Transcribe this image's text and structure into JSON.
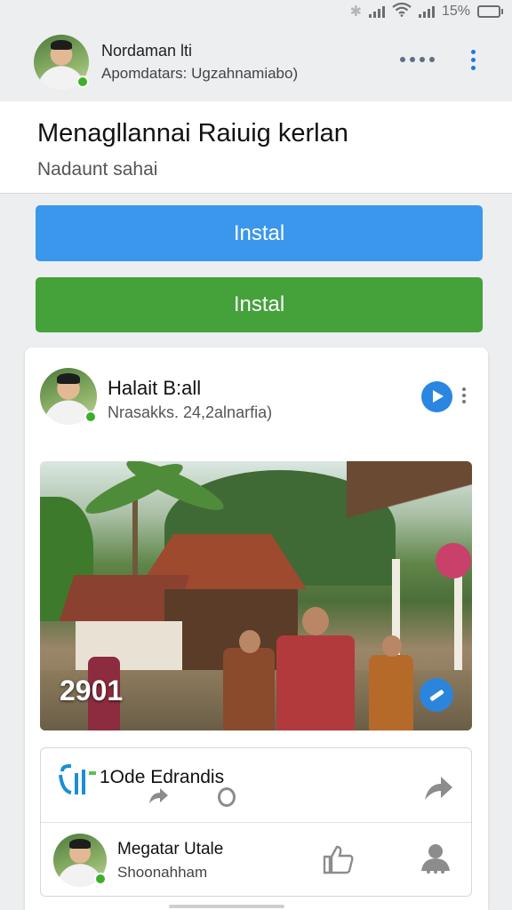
{
  "status": {
    "battery": "15%"
  },
  "header": {
    "user_name": "Nordaman lti",
    "user_sub": "Apomdatars: Ugzahnamiabo)"
  },
  "title_card": {
    "title": "Menagllannai Raiuig kerlan",
    "subtitle": "Nadaunt sahai"
  },
  "buttons": {
    "primary_label": "Instal",
    "secondary_label": "Instal",
    "primary_color": "#3b97ec",
    "secondary_color": "#45a13a"
  },
  "post": {
    "author_name": "Halait B:all",
    "author_sub": "Nrasakks. 24,2alnarfia)",
    "photo_count": "2901",
    "action_label": "1Ode Edrandis",
    "comment": {
      "name": "Megatar Utale",
      "sub": "Shoonahham"
    }
  },
  "icons": [
    "wifi-icon",
    "signal-icon",
    "battery-icon",
    "more-horizontal-icon",
    "more-vertical-icon",
    "play-icon",
    "share-icon",
    "reply-icon",
    "forward-icon",
    "like-icon",
    "person-icon"
  ]
}
